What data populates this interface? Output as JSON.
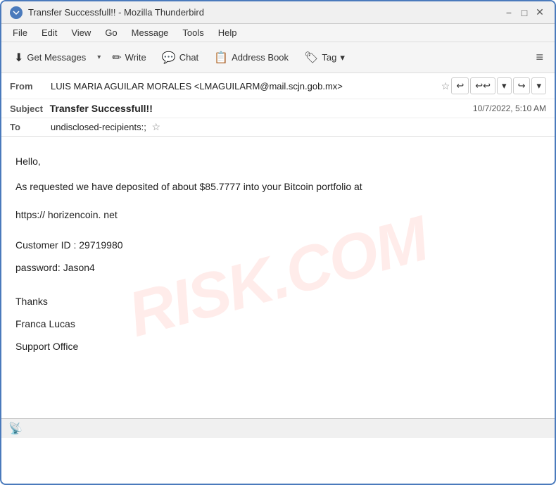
{
  "titleBar": {
    "title": "Transfer Successfull!! - Mozilla Thunderbird",
    "icon": "T",
    "minimizeLabel": "−",
    "maximizeLabel": "□",
    "closeLabel": "✕"
  },
  "menuBar": {
    "items": [
      "File",
      "Edit",
      "View",
      "Go",
      "Message",
      "Tools",
      "Help"
    ]
  },
  "toolbar": {
    "getMessagesLabel": "Get Messages",
    "writeLabel": "Write",
    "chatLabel": "Chat",
    "addressBookLabel": "Address Book",
    "tagLabel": "Tag",
    "hamburgerIcon": "≡"
  },
  "emailHeader": {
    "fromLabel": "From",
    "fromValue": "LUIS MARIA AGUILAR MORALES <LMAGUILARM@mail.scjn.gob.mx>",
    "subjectLabel": "Subject",
    "subjectValue": "Transfer Successfull!!",
    "date": "10/7/2022, 5:10 AM",
    "toLabel": "To",
    "toValue": "undisclosed-recipients:;"
  },
  "emailBody": {
    "line1": "Hello,",
    "line2": "",
    "line3": "As requested we have deposited of about $85.7777 into your Bitcoin portfolio at",
    "line4": "",
    "line5": "https:// horizencoin. net",
    "line6": "",
    "line7": "",
    "line8": "Customer ID : 29719980",
    "line9": "password:    Jason4",
    "line10": "",
    "line11": "",
    "line12": "Thanks",
    "line13": "Franca Lucas",
    "line14": "Support Office"
  },
  "watermark": "RISK.COM",
  "statusBar": {
    "icon": "📡"
  }
}
